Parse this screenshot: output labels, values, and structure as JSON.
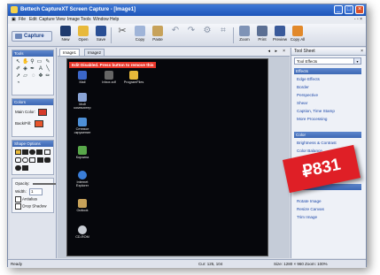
{
  "window": {
    "title": "Bettech CaptureXT Screen Capture - [Image1]"
  },
  "menu": [
    "File",
    "Edit",
    "Capture",
    "View",
    "Image",
    "Tools",
    "Window",
    "Help"
  ],
  "toolbar": {
    "capture_label": "Capture",
    "buttons": [
      "New",
      "Open",
      "Save",
      "Copy",
      "Paste",
      "Zoom",
      "Print",
      "Preview",
      "Copy All"
    ]
  },
  "left_panel": {
    "tools_title": "Tools",
    "colors_title": "Colors",
    "main_color_label": "Main Color:",
    "back_label": "Back/Fill:",
    "shapes_title": "Shape Options",
    "opacity_label": "Opacity:",
    "width_label": "Width:",
    "width_value": "1",
    "antialias_label": "Antialias",
    "shadow_label": "Drop Shadow",
    "colors": {
      "main": "#d63a2a",
      "back": "#e8552c"
    }
  },
  "document": {
    "tabs": [
      "Image1",
      "Image2"
    ],
    "banner": "Edit Disabled. Press button to remove this",
    "desktop_icons": [
      "Mail",
      "Inbox.xdf",
      "ProgramFiles",
      "Мой компьютер",
      "Сетевое окружение",
      "Корзина",
      "Internet Explorer",
      "Outlook",
      "CD-ROM"
    ]
  },
  "right_panel": {
    "title": "Tool Sheet",
    "combo_value": "Tool Effects",
    "sections": [
      {
        "title": "Effects",
        "items": [
          "Edge Effects",
          "Border",
          "Perspective",
          "Shear",
          "Caption, Time Stamp",
          "More Processing"
        ]
      },
      {
        "title": "Color",
        "items": [
          "Brightness & Contrast",
          "Color Balance"
        ]
      },
      {
        "title": "",
        "items": [
          "Rotate Image",
          "Resize Canvas",
          "Trim Image"
        ]
      }
    ]
  },
  "status": {
    "left": "Ready",
    "mid": "Cur: 125, 104",
    "right": "Size: 1280 × 960   Zoom: 100%"
  },
  "price_sticker": "₽831"
}
